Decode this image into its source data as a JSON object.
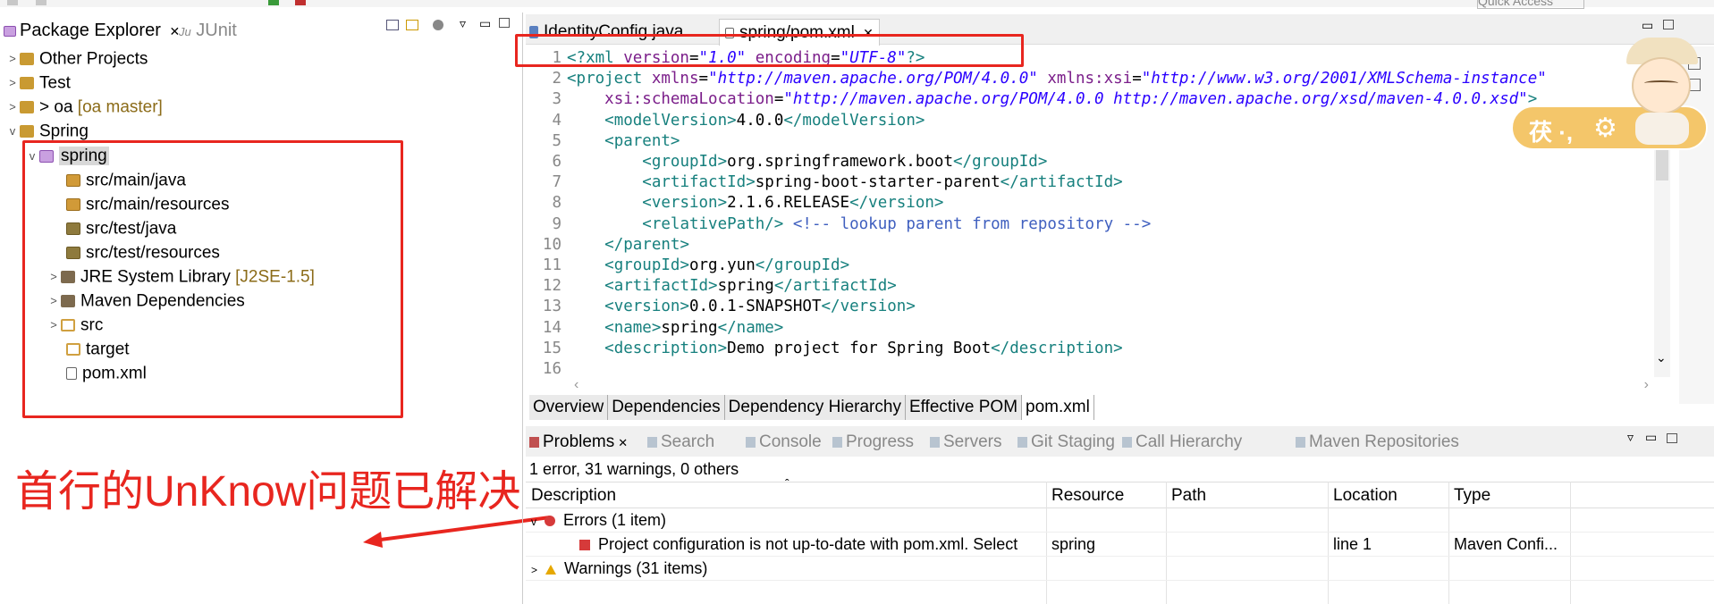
{
  "toolbar": {
    "quick_access": "Quick Access"
  },
  "package_explorer": {
    "tab_label": "Package Explorer",
    "junit_tab": "JUnit",
    "tree": [
      {
        "label": "Other Projects",
        "suffix": ""
      },
      {
        "label": "Test",
        "suffix": ""
      },
      {
        "label": "> oa",
        "suffix": "[oa master]"
      },
      {
        "label": "Spring",
        "suffix": ""
      },
      {
        "label": "spring",
        "suffix": ""
      },
      {
        "label": "src/main/java",
        "suffix": ""
      },
      {
        "label": "src/main/resources",
        "suffix": ""
      },
      {
        "label": "src/test/java",
        "suffix": ""
      },
      {
        "label": "src/test/resources",
        "suffix": ""
      },
      {
        "label": "JRE System Library",
        "suffix": "[J2SE-1.5]"
      },
      {
        "label": "Maven Dependencies",
        "suffix": ""
      },
      {
        "label": "src",
        "suffix": ""
      },
      {
        "label": "target",
        "suffix": ""
      },
      {
        "label": "pom.xml",
        "suffix": ""
      }
    ]
  },
  "editor": {
    "tabs": [
      "IdentityConfig.java",
      "spring/pom.xml"
    ],
    "lines": [
      {
        "n": "1",
        "segs": [
          [
            "t",
            "<?xml "
          ],
          [
            "a",
            "version"
          ],
          [
            "p",
            "="
          ],
          [
            "s",
            "\"1.0\""
          ],
          [
            "p",
            " "
          ],
          [
            "a",
            "encoding"
          ],
          [
            "p",
            "="
          ],
          [
            "s",
            "\"UTF-8\""
          ],
          [
            "t",
            "?>"
          ]
        ]
      },
      {
        "n": "2",
        "segs": [
          [
            "t",
            "<project "
          ],
          [
            "a",
            "xmlns"
          ],
          [
            "p",
            "="
          ],
          [
            "s",
            "\"http://maven.apache.org/POM/4.0.0\""
          ],
          [
            "p",
            " "
          ],
          [
            "a",
            "xmlns:xsi"
          ],
          [
            "p",
            "="
          ],
          [
            "s",
            "\"http://www.w3.org/2001/XMLSchema-instance\""
          ]
        ]
      },
      {
        "n": "3",
        "segs": [
          [
            "p",
            "    "
          ],
          [
            "a",
            "xsi:schemaLocation"
          ],
          [
            "p",
            "="
          ],
          [
            "s",
            "\"http://maven.apache.org/POM/4.0.0 http://maven.apache.org/xsd/maven-4.0.0.xsd\""
          ],
          [
            "t",
            ">"
          ]
        ]
      },
      {
        "n": "4",
        "segs": [
          [
            "p",
            "    "
          ],
          [
            "t",
            "<modelVersion>"
          ],
          [
            "p",
            "4.0.0"
          ],
          [
            "t",
            "</modelVersion>"
          ]
        ]
      },
      {
        "n": "5",
        "segs": [
          [
            "p",
            "    "
          ],
          [
            "t",
            "<parent>"
          ]
        ]
      },
      {
        "n": "6",
        "segs": [
          [
            "p",
            "        "
          ],
          [
            "t",
            "<groupId>"
          ],
          [
            "p",
            "org.springframework.boot"
          ],
          [
            "t",
            "</groupId>"
          ]
        ]
      },
      {
        "n": "7",
        "segs": [
          [
            "p",
            "        "
          ],
          [
            "t",
            "<artifactId>"
          ],
          [
            "p",
            "spring-boot-starter-parent"
          ],
          [
            "t",
            "</artifactId>"
          ]
        ]
      },
      {
        "n": "8",
        "segs": [
          [
            "p",
            "        "
          ],
          [
            "t",
            "<version>"
          ],
          [
            "p",
            "2.1.6.RELEASE"
          ],
          [
            "t",
            "</version>"
          ]
        ]
      },
      {
        "n": "9",
        "segs": [
          [
            "p",
            "        "
          ],
          [
            "t",
            "<relativePath/>"
          ],
          [
            "p",
            " "
          ],
          [
            "c",
            "<!-- lookup parent from repository -->"
          ]
        ]
      },
      {
        "n": "10",
        "segs": [
          [
            "p",
            "    "
          ],
          [
            "t",
            "</parent>"
          ]
        ]
      },
      {
        "n": "11",
        "segs": [
          [
            "p",
            "    "
          ],
          [
            "t",
            "<groupId>"
          ],
          [
            "p",
            "org.yun"
          ],
          [
            "t",
            "</groupId>"
          ]
        ]
      },
      {
        "n": "12",
        "segs": [
          [
            "p",
            "    "
          ],
          [
            "t",
            "<artifactId>"
          ],
          [
            "p",
            "spring"
          ],
          [
            "t",
            "</artifactId>"
          ]
        ]
      },
      {
        "n": "13",
        "segs": [
          [
            "p",
            "    "
          ],
          [
            "t",
            "<version>"
          ],
          [
            "p",
            "0.0.1-SNAPSHOT"
          ],
          [
            "t",
            "</version>"
          ]
        ]
      },
      {
        "n": "14",
        "segs": [
          [
            "p",
            "    "
          ],
          [
            "t",
            "<name>"
          ],
          [
            "p",
            "spring"
          ],
          [
            "t",
            "</name>"
          ]
        ]
      },
      {
        "n": "15",
        "segs": [
          [
            "p",
            "    "
          ],
          [
            "t",
            "<description>"
          ],
          [
            "p",
            "Demo project for Spring Boot"
          ],
          [
            "t",
            "</description>"
          ]
        ]
      },
      {
        "n": "16",
        "segs": []
      }
    ],
    "bottom_tabs": [
      "Overview",
      "Dependencies",
      "Dependency Hierarchy",
      "Effective POM",
      "pom.xml"
    ]
  },
  "sticker_text": "茯 ·,",
  "problems": {
    "tabs": [
      "Problems",
      "Search",
      "Console",
      "Progress",
      "Servers",
      "Git Staging",
      "Call Hierarchy",
      "Maven Repositories"
    ],
    "summary": "1 error, 31 warnings, 0 others",
    "columns": [
      "Description",
      "Resource",
      "Path",
      "Location",
      "Type"
    ],
    "errors_group": "Errors (1 item)",
    "error_row": {
      "description": "Project configuration is not up-to-date with pom.xml. Select",
      "resource": "spring",
      "path": "",
      "location": "line 1",
      "type": "Maven Confi..."
    },
    "warnings_group": "Warnings (31 items)"
  },
  "annotation": {
    "text": "首行的UnKnow问题已解决",
    "color": "#e8261f"
  }
}
